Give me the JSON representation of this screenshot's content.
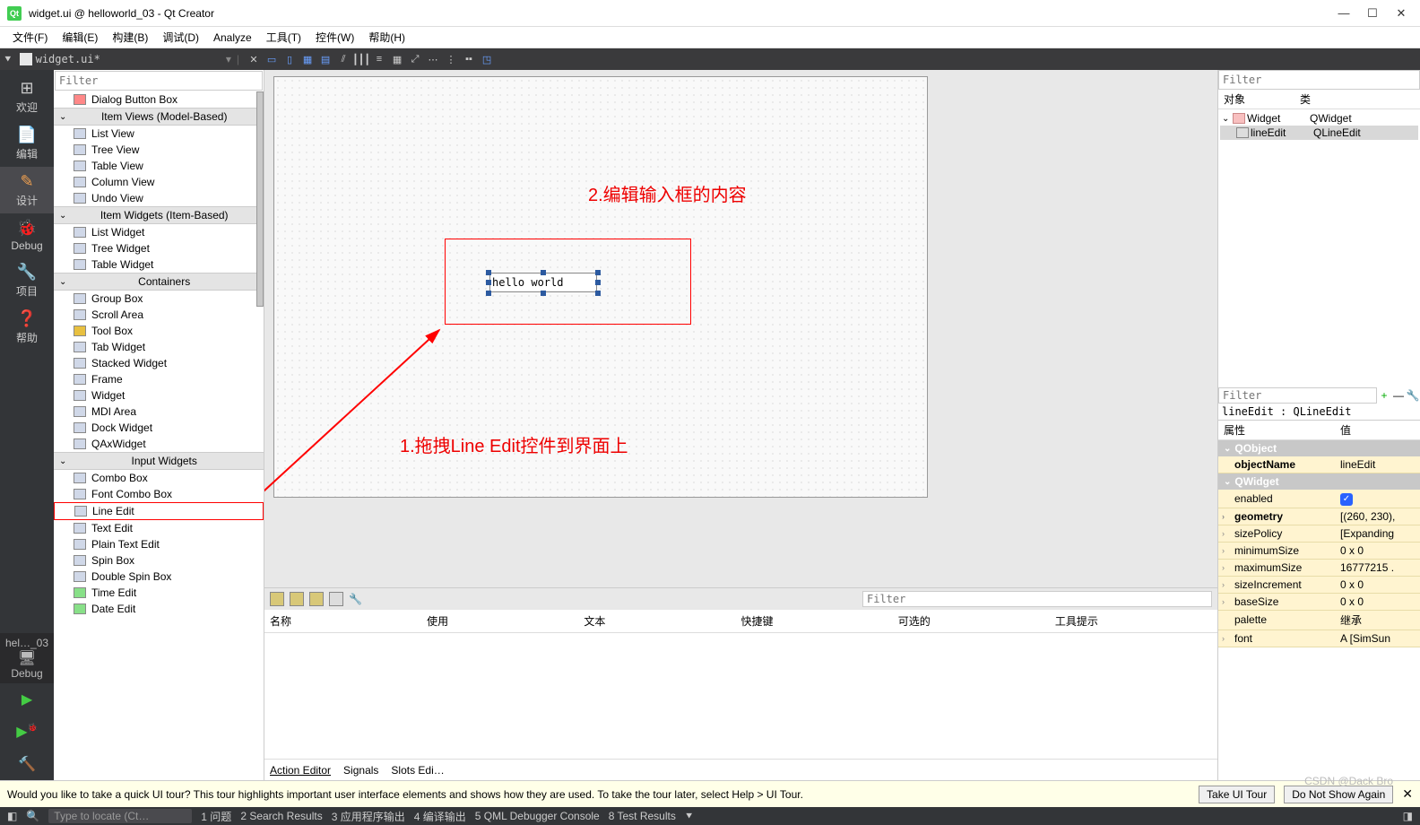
{
  "window": {
    "title": "widget.ui @ helloworld_03 - Qt Creator"
  },
  "menu": {
    "file": "文件(F)",
    "edit": "编辑(E)",
    "build": "构建(B)",
    "debug": "调试(D)",
    "analyze": "Analyze",
    "tools": "工具(T)",
    "widgets": "控件(W)",
    "help": "帮助(H)"
  },
  "tab": {
    "filename": "widget.ui*"
  },
  "rail": {
    "welcome": "欢迎",
    "edit": "编辑",
    "design": "设计",
    "debug": "Debug",
    "projects": "项目",
    "help": "帮助",
    "project_tab": "hel…_03",
    "debug2": "Debug"
  },
  "filter_placeholder": "Filter",
  "widget_box": {
    "dialog_button_box": "Dialog Button Box",
    "cat_item_views": "Item Views (Model-Based)",
    "list_view": "List View",
    "tree_view": "Tree View",
    "table_view": "Table View",
    "column_view": "Column View",
    "undo_view": "Undo View",
    "cat_item_widgets": "Item Widgets (Item-Based)",
    "list_widget": "List Widget",
    "tree_widget": "Tree Widget",
    "table_widget": "Table Widget",
    "cat_containers": "Containers",
    "group_box": "Group Box",
    "scroll_area": "Scroll Area",
    "tool_box": "Tool Box",
    "tab_widget": "Tab Widget",
    "stacked_widget": "Stacked Widget",
    "frame": "Frame",
    "widget": "Widget",
    "mdi_area": "MDI Area",
    "dock_widget": "Dock Widget",
    "qax_widget": "QAxWidget",
    "cat_input": "Input Widgets",
    "combo_box": "Combo Box",
    "font_combo": "Font Combo Box",
    "line_edit": "Line Edit",
    "text_edit": "Text Edit",
    "plain_text": "Plain Text Edit",
    "spin_box": "Spin Box",
    "double_spin": "Double Spin Box",
    "time_edit": "Time Edit",
    "date_edit": "Date Edit"
  },
  "canvas": {
    "line_edit_value": "hello world",
    "annotation1": "1.拖拽Line Edit控件到界面上",
    "annotation2": "2.编辑输入框的内容"
  },
  "action_editor": {
    "cols": {
      "name": "名称",
      "used": "使用",
      "text": "文本",
      "shortcut": "快捷键",
      "optional": "可选的",
      "tooltip": "工具提示"
    },
    "tabs": {
      "action": "Action Editor",
      "signals": "Signals",
      "slots": "Slots Edi…"
    }
  },
  "inspector": {
    "cols": {
      "obj": "对象",
      "cls": "类"
    },
    "row1_name": "Widget",
    "row1_cls": "QWidget",
    "row2_name": "lineEdit",
    "row2_cls": "QLineEdit"
  },
  "prop": {
    "obj_line": "lineEdit : QLineEdit",
    "cols": {
      "name": "属性",
      "value": "值"
    },
    "cat_qobject": "QObject",
    "objectName_k": "objectName",
    "objectName_v": "lineEdit",
    "cat_qwidget": "QWidget",
    "enabled_k": "enabled",
    "geometry_k": "geometry",
    "geometry_v": "[(260, 230),",
    "sizePolicy_k": "sizePolicy",
    "sizePolicy_v": "[Expanding",
    "minimumSize_k": "minimumSize",
    "minimumSize_v": "0 x 0",
    "maximumSize_k": "maximumSize",
    "maximumSize_v": "16777215 .",
    "sizeIncrement_k": "sizeIncrement",
    "sizeIncrement_v": "0 x 0",
    "baseSize_k": "baseSize",
    "baseSize_v": "0 x 0",
    "palette_k": "palette",
    "palette_v": "继承",
    "font_k": "font",
    "font_v": "A [SimSun"
  },
  "info": {
    "msg": "Would you like to take a quick UI tour? This tour highlights important user interface elements and shows how they are used. To take the tour later, select Help > UI Tour.",
    "btn1": "Take UI Tour",
    "btn2": "Do Not Show Again"
  },
  "status": {
    "search": "Type to locate (Ct…",
    "issues": "1 问题",
    "search_results": "2 Search Results",
    "app_output": "3 应用程序输出",
    "compile": "4 编译输出",
    "qml": "5 QML Debugger Console",
    "tests": "8 Test Results"
  },
  "watermark": "CSDN @Dack Bro"
}
